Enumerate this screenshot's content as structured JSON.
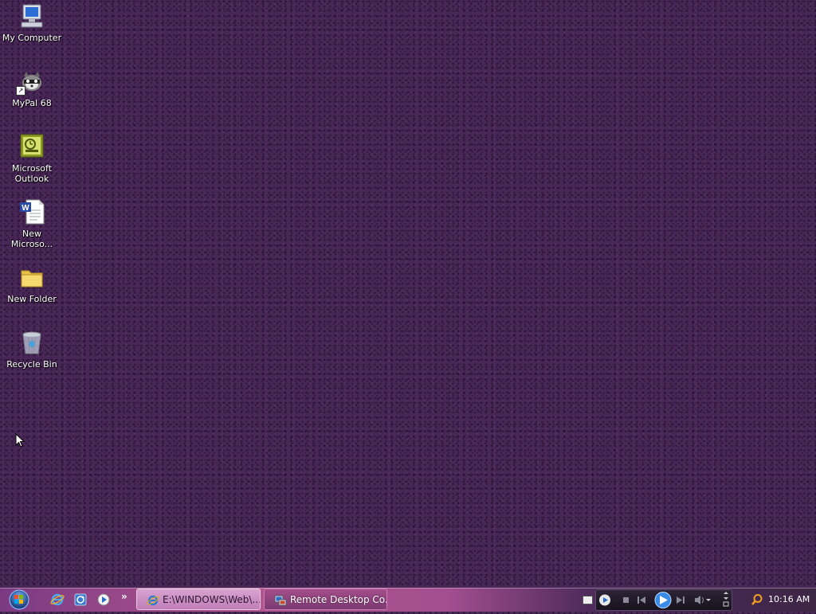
{
  "desktop": {
    "icons": [
      {
        "label": "My Computer"
      },
      {
        "label": "MyPal 68"
      },
      {
        "label": "Microsoft Outlook"
      },
      {
        "label": "New Microso..."
      },
      {
        "label": "New Folder"
      },
      {
        "label": "Recycle Bin"
      }
    ]
  },
  "taskbar": {
    "start_icon": "windows-logo",
    "quick_launch": [
      "internet-explorer-icon",
      "windows-update-icon",
      "media-player-icon"
    ],
    "chevron": "»",
    "tasks": [
      {
        "label": "E:\\WINDOWS\\Web\\..."
      },
      {
        "label": "Remote Desktop Co..."
      }
    ],
    "tray": {
      "clock": "10:16 AM",
      "search_icon": "search-icon"
    }
  },
  "colors": {
    "desktop_bg": "#482756",
    "taskbar_accent": "#b5578f"
  }
}
